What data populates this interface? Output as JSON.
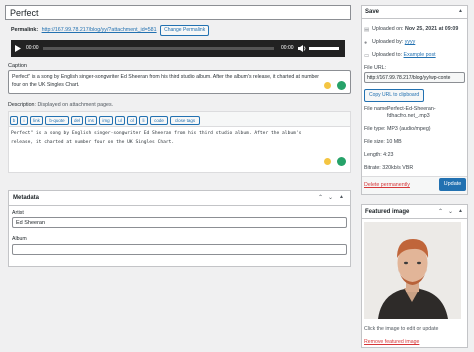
{
  "title_input": "Perfect",
  "permalink": {
    "label": "Permalink:",
    "url": "http://167.99.78.217/blog/yy/?attachment_id=581",
    "change_button": "Change Permalink"
  },
  "audio": {
    "current": "00:00",
    "duration": "00:00"
  },
  "caption": {
    "label": "Caption",
    "text": "Perfect\" is a song by English singer-songwriter Ed Sheeran from his third studio album. After the album's release, it charted at number four on the UK Singles Chart."
  },
  "description": {
    "label": "Description",
    "note": ": Displayed on attachment pages.",
    "toolbar": [
      "b",
      "i",
      "link",
      "b-quote",
      "del",
      "ins",
      "img",
      "ul",
      "ol",
      "li",
      "code",
      "close tags"
    ],
    "text": "Perfect\" is a song by English singer-songwriter Ed Sheeran from his third studio album. After the album's release, it charted at number four on the UK Singles Chart."
  },
  "metadata": {
    "title": "Metadata",
    "artist_label": "Artist",
    "artist_value": "Ed Sheeran",
    "album_label": "Album",
    "album_value": ""
  },
  "save": {
    "title": "Save",
    "uploaded_on_label": "Uploaded on:",
    "uploaded_on": "Nov 25, 2021 at 09:09",
    "uploaded_by_label": "Uploaded by:",
    "uploaded_by": "yyyy",
    "uploaded_to_label": "Uploaded to:",
    "uploaded_to": "Example post",
    "file_url_label": "File URL:",
    "file_url": "http://167.99.78.217/blog/yy/wp-conte",
    "copy_button": "Copy URL to clipboard",
    "file_name_label": "File name:",
    "file_name": "Perfect-Ed-Sheeran-fdhacfro.net_.mp3",
    "file_type_label": "File type:",
    "file_type": "MP3 (audio/mpeg)",
    "file_size_label": "File size:",
    "file_size": "10 MB",
    "length_label": "Length:",
    "length": "4:23",
    "bitrate_label": "Bitrate:",
    "bitrate": "320kb/s VBR",
    "delete_link": "Delete permanently",
    "update_button": "Update"
  },
  "featured_image": {
    "title": "Featured image",
    "hint": "Click the image to edit or update",
    "remove_link": "Remove featured image"
  },
  "colors": {
    "accent": "#2271b1",
    "danger": "#d63638",
    "player_bg": "#222222"
  }
}
